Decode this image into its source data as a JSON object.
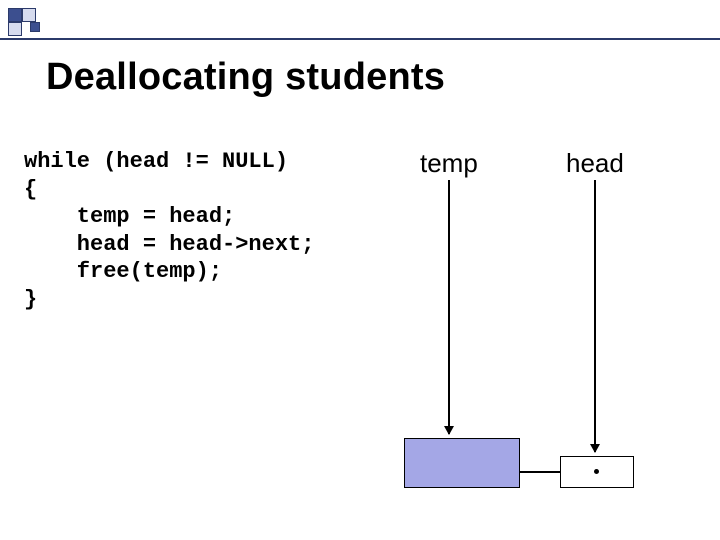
{
  "title": "Deallocating students",
  "code": "while (head != NULL)\n{\n    temp = head;\n    head = head->next;\n    free(temp);\n}",
  "labels": {
    "temp": "temp",
    "head": "head"
  },
  "colors": {
    "node_fill": "#a4a7e6",
    "rule": "#2b3a6a",
    "logo_dark": "#3c4f8f",
    "logo_light": "#d6dbee"
  }
}
